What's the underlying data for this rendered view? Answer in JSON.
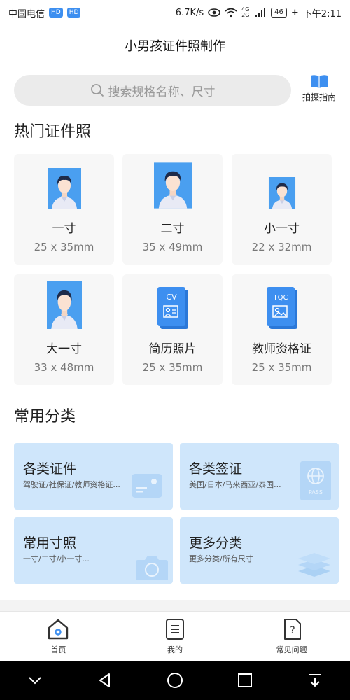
{
  "status": {
    "carrier": "中国电信",
    "hd1": "HD",
    "hd2": "HD",
    "speed": "6.7K/s",
    "network": "4G 2G",
    "battery": "46",
    "time": "下午2:11"
  },
  "app": {
    "title": "小男孩证件照制作"
  },
  "search": {
    "placeholder": "搜索规格名称、尺寸"
  },
  "guide": {
    "label": "拍摄指南"
  },
  "hot": {
    "title": "热门证件照",
    "items": [
      {
        "name": "一寸",
        "size": "25 x 35mm",
        "icon": "portrait-icon"
      },
      {
        "name": "二寸",
        "size": "35 x 49mm",
        "icon": "portrait-icon"
      },
      {
        "name": "小一寸",
        "size": "22 x 32mm",
        "icon": "portrait-icon"
      },
      {
        "name": "大一寸",
        "size": "33 x 48mm",
        "icon": "portrait-icon"
      },
      {
        "name": "简历照片",
        "size": "25 x 35mm",
        "icon": "cv-icon",
        "badge": "CV"
      },
      {
        "name": "教师资格证",
        "size": "25 x 35mm",
        "icon": "tqc-icon",
        "badge": "TQC"
      }
    ]
  },
  "categories": {
    "title": "常用分类",
    "items": [
      {
        "name": "各类证件",
        "sub": "驾驶证/社保证/教师资格证...",
        "icon": "id-card-icon"
      },
      {
        "name": "各类签证",
        "sub": "美国/日本/马来西亚/泰国...",
        "icon": "passport-icon",
        "icon_text": "PASS"
      },
      {
        "name": "常用寸照",
        "sub": "一寸/二寸/小一寸...",
        "icon": "camera-icon"
      },
      {
        "name": "更多分类",
        "sub": "更多分类/所有尺寸",
        "icon": "layers-icon"
      }
    ]
  },
  "tabs": [
    {
      "label": "首页",
      "icon": "home-icon"
    },
    {
      "label": "我的",
      "icon": "document-icon"
    },
    {
      "label": "常见问题",
      "icon": "question-icon"
    }
  ],
  "colors": {
    "accent": "#3d8ff0",
    "photo_bg": "#4a9ff0",
    "category_bg": "#cfe6fb",
    "card_bg": "#f7f7f7"
  }
}
